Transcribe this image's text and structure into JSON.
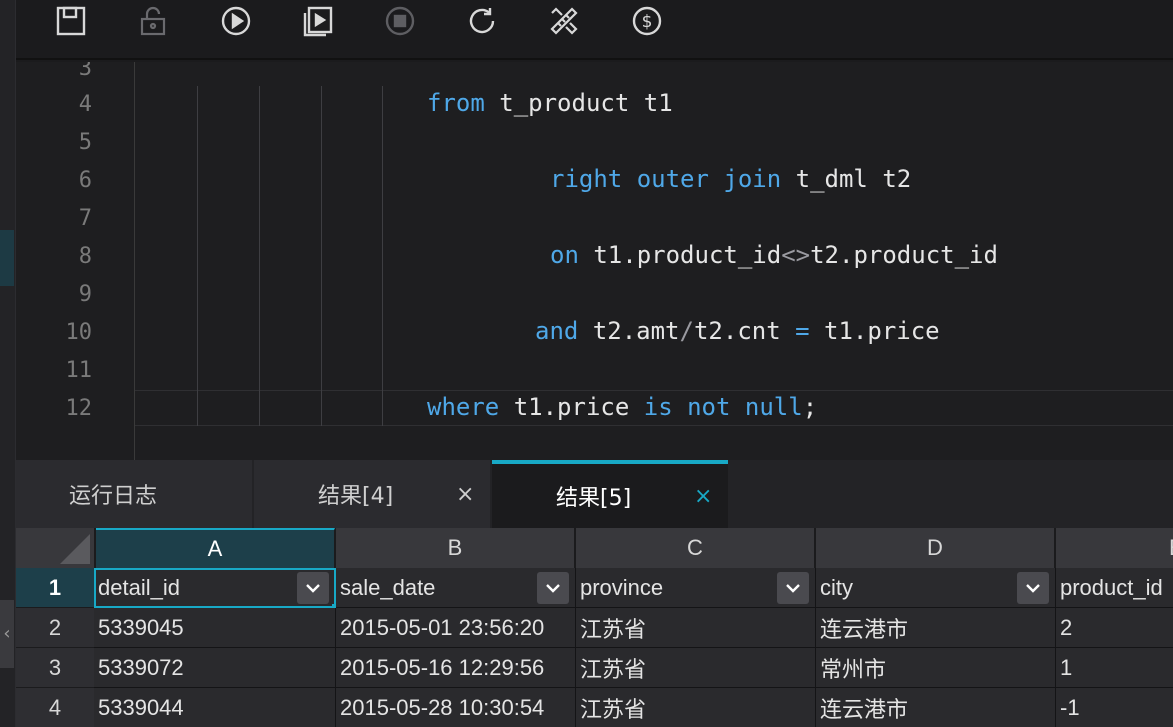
{
  "toolbar": {
    "icons": [
      "save-icon",
      "lock-icon",
      "run-icon",
      "run-file-icon",
      "stop-icon",
      "refresh-icon",
      "format-icon",
      "cost-icon"
    ]
  },
  "editor": {
    "line_numbers": [
      "3",
      "4",
      "5",
      "6",
      "7",
      "8",
      "9",
      "10",
      "11",
      "12"
    ],
    "lines": {
      "l4": {
        "kw1": "from",
        "t1": " t_product t1"
      },
      "l6": {
        "kw1": "right outer join",
        "t1": " t_dml t2"
      },
      "l8": {
        "kw1": "on",
        "t1": " t1.product_id",
        "op1": "<>",
        "t2": "t2.product_id"
      },
      "l10": {
        "kw1": "and",
        "t1": " t2.amt",
        "op1": "/",
        "t2": "t2.cnt ",
        "op2": "=",
        "t3": " t1.price"
      },
      "l12": {
        "kw1": "where",
        "t1": " t1.price ",
        "kw2": "is not null",
        "t2": ";"
      }
    }
  },
  "tabs": [
    {
      "label": "运行日志"
    },
    {
      "label": "结果[4]",
      "close": "×"
    },
    {
      "label": "结果[5]",
      "close": "×"
    }
  ],
  "grid": {
    "columns": [
      "A",
      "B",
      "C",
      "D",
      "E"
    ],
    "row_numbers": [
      "1",
      "2",
      "3",
      "4"
    ],
    "header_row": [
      "detail_id",
      "sale_date",
      "province",
      "city",
      "product_id"
    ],
    "rows": [
      [
        "5339045",
        "2015-05-01 23:56:20",
        "江苏省",
        "连云港市",
        "2"
      ],
      [
        "5339072",
        "2015-05-16 12:29:56",
        "江苏省",
        "常州市",
        "1"
      ],
      [
        "5339044",
        "2015-05-28 10:30:54",
        "江苏省",
        "连云港市",
        "-1"
      ]
    ]
  },
  "left_strip": {
    "collapse_glyph": "‹"
  }
}
